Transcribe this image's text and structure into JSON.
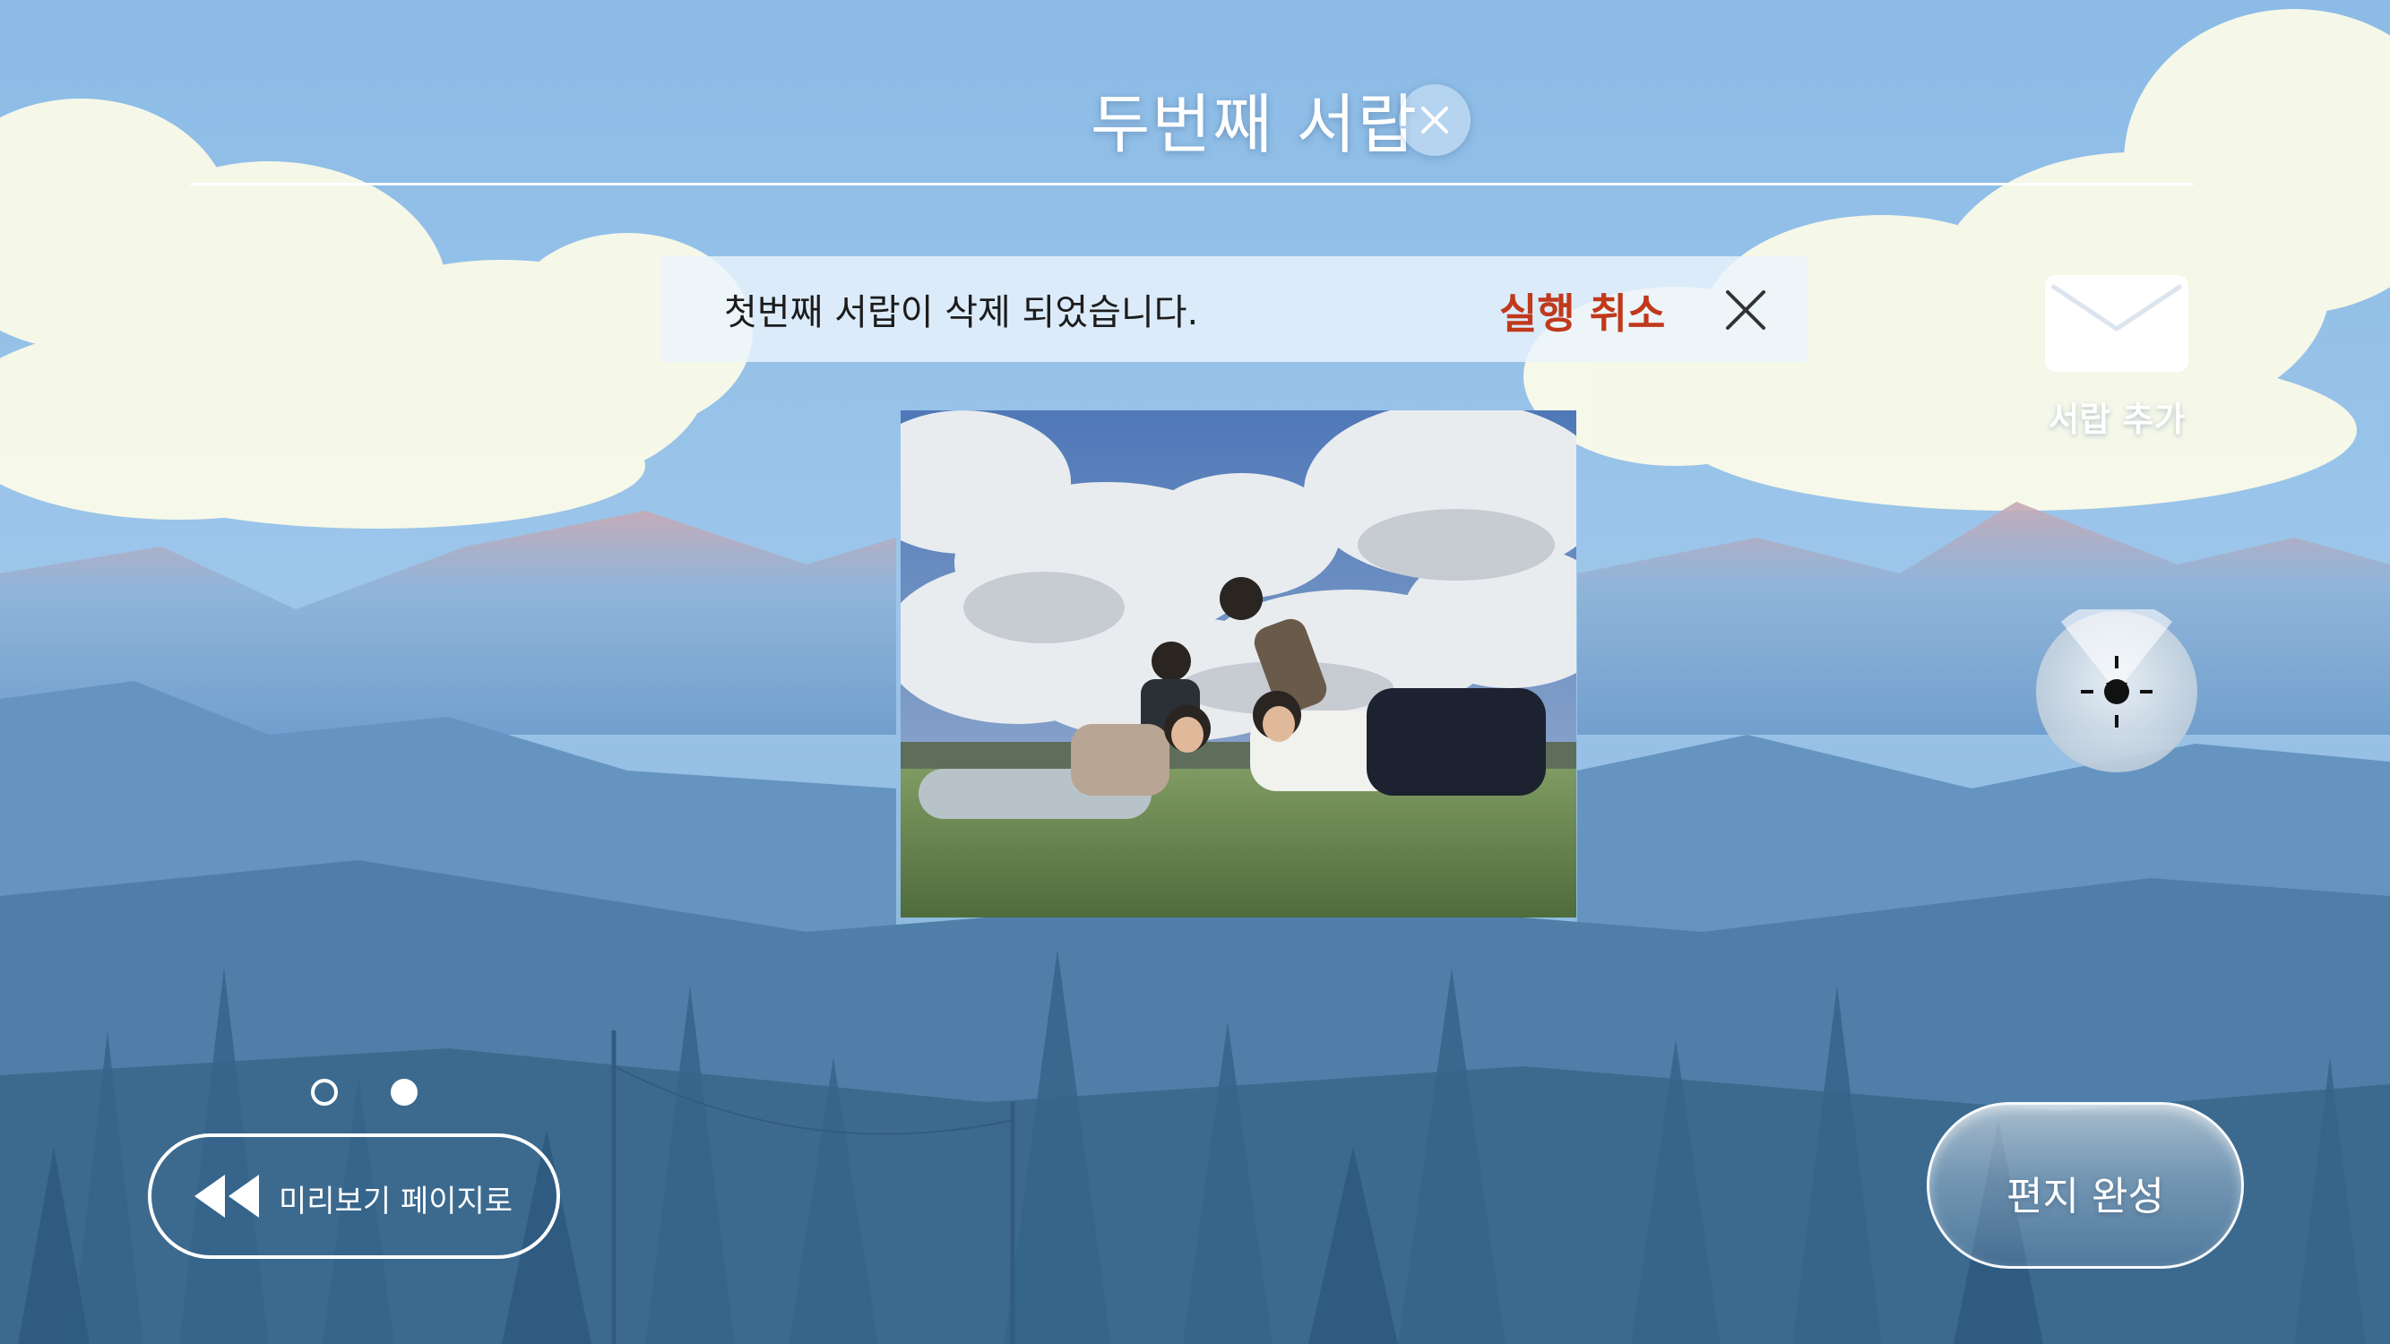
{
  "header": {
    "title": "두번째 서랍"
  },
  "snackbar": {
    "message": "첫번째 서랍이 삭제 되었습니다.",
    "undo_label": "실행 취소"
  },
  "side_tools": {
    "add_drawer_label": "서랍 추가"
  },
  "pagination": {
    "total_pages": 2,
    "current_page": 2
  },
  "footer": {
    "back_label": "미리보기 페이지로",
    "finish_label": "편지 완성"
  },
  "colors": {
    "undo_accent": "#c0391b",
    "sky": "#7fb0dc",
    "snackbar_background": "#ecf4fc"
  },
  "icons": {
    "title_close": "close-icon",
    "snackbar_close": "close-icon",
    "add_drawer": "envelope-icon",
    "tool": "clock-light-icon",
    "back": "rewind-icon"
  }
}
